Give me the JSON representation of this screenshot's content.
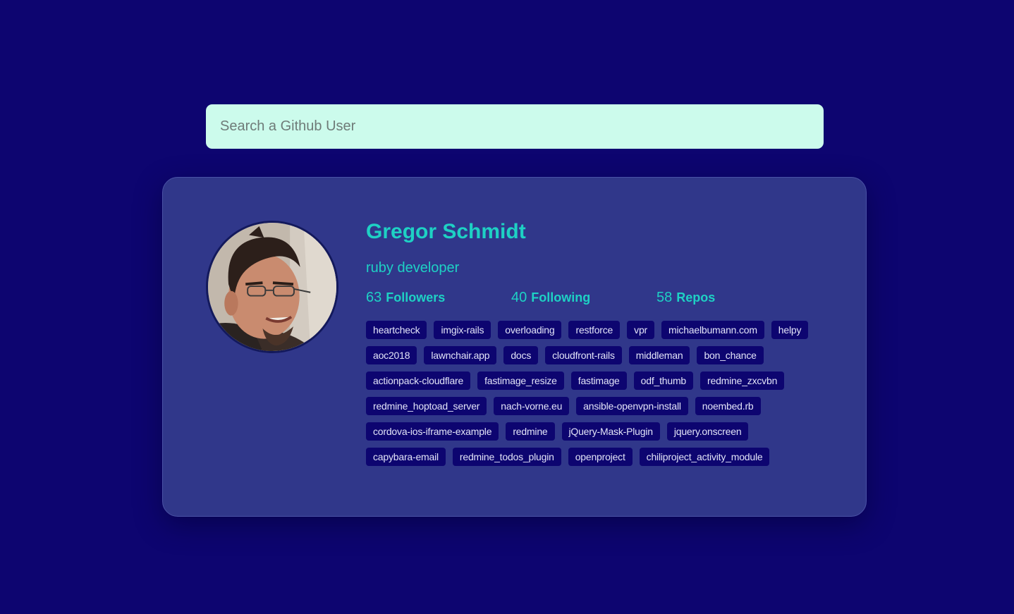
{
  "search": {
    "placeholder": "Search a Github User",
    "value": ""
  },
  "profile": {
    "name": "Gregor Schmidt",
    "bio": "ruby developer",
    "avatar_icon": "user-avatar-photo",
    "stats": [
      {
        "count": "63",
        "label": "Followers"
      },
      {
        "count": "40",
        "label": "Following"
      },
      {
        "count": "58",
        "label": "Repos"
      }
    ],
    "repos": [
      "heartcheck",
      "imgix-rails",
      "overloading",
      "restforce",
      "vpr",
      "michaelbumann.com",
      "helpy",
      "aoc2018",
      "lawnchair.app",
      "docs",
      "cloudfront-rails",
      "middleman",
      "bon_chance",
      "actionpack-cloudflare",
      "fastimage_resize",
      "fastimage",
      "odf_thumb",
      "redmine_zxcvbn",
      "redmine_hoptoad_server",
      "nach-vorne.eu",
      "ansible-openvpn-install",
      "noembed.rb",
      "cordova-ios-iframe-example",
      "redmine",
      "jQuery-Mask-Plugin",
      "jquery.onscreen",
      "capybara-email",
      "redmine_todos_plugin",
      "openproject",
      "chiliproject_activity_module"
    ]
  },
  "colors": {
    "background": "#0d0570",
    "card": "#30378a",
    "accent": "#1ed1c4",
    "search_bg": "#ccfbec",
    "repo_bg": "#0d0570"
  }
}
